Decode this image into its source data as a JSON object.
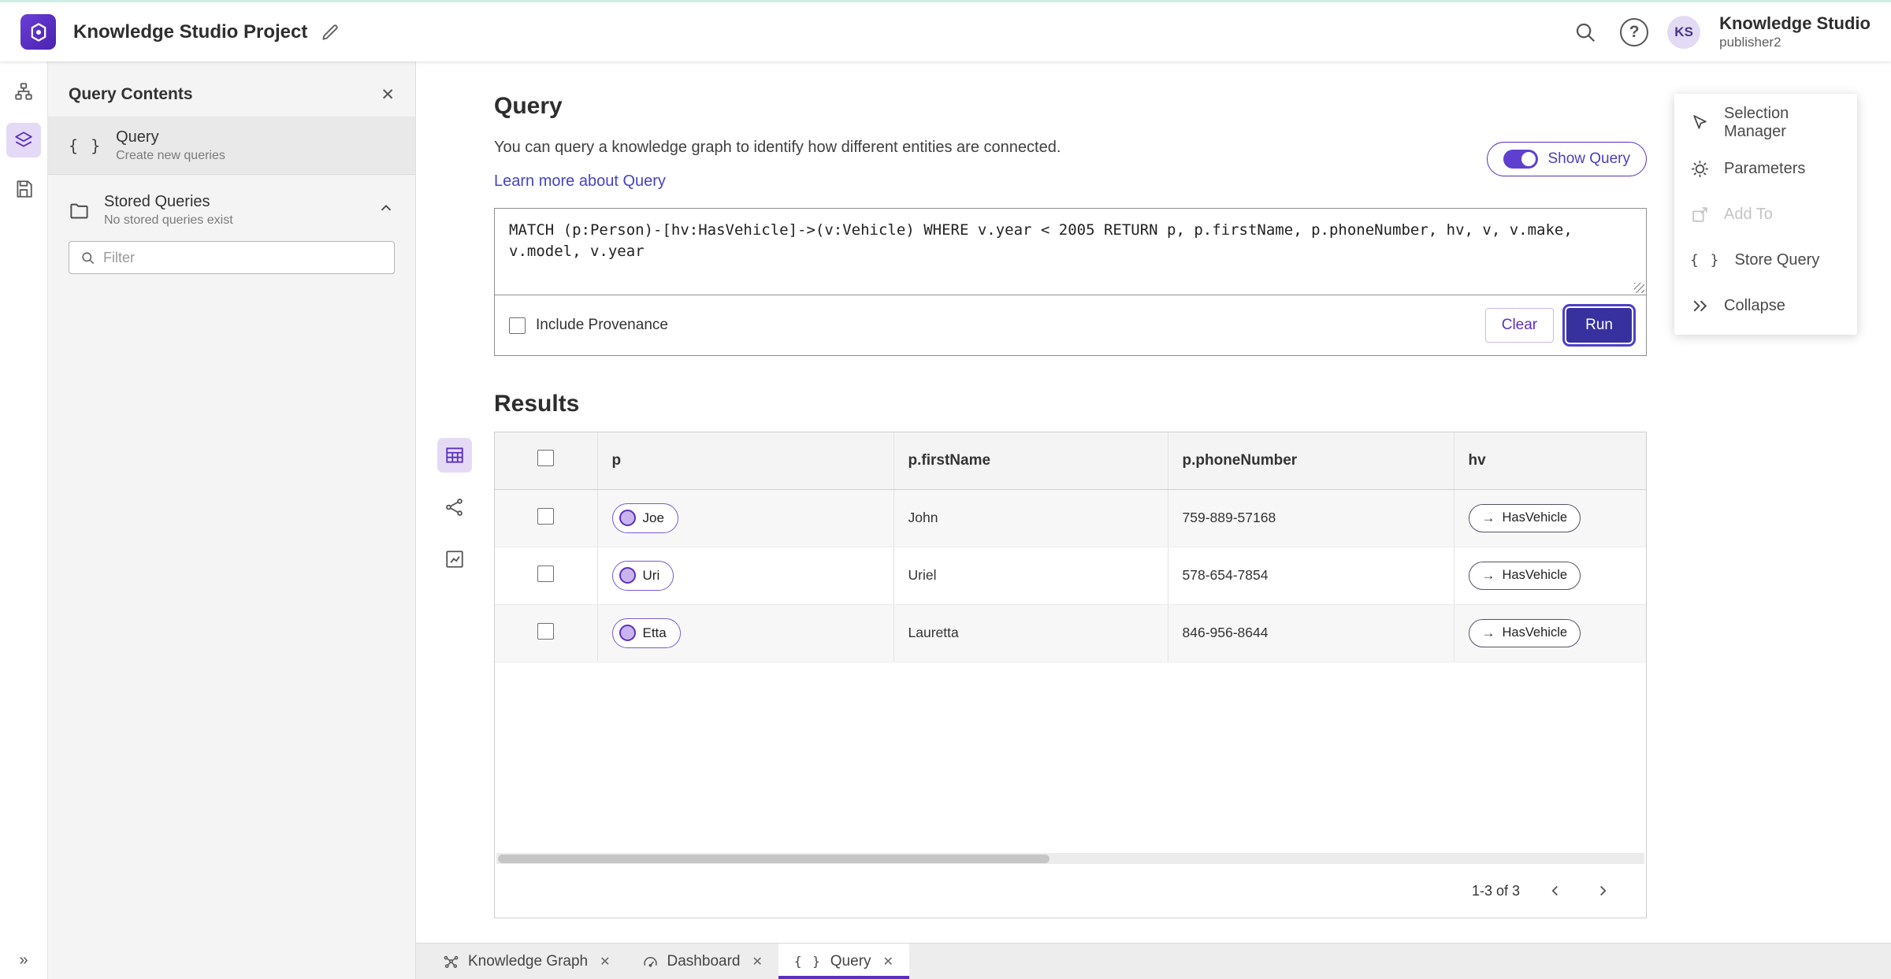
{
  "header": {
    "title": "Knowledge Studio Project",
    "product_name": "Knowledge Studio",
    "user_role": "publisher2",
    "avatar_initials": "KS"
  },
  "left_panel": {
    "title": "Query Contents",
    "query_item": {
      "label": "Query",
      "description": "Create new queries"
    },
    "stored": {
      "label": "Stored Queries",
      "description": "No stored queries exist"
    },
    "filter_placeholder": "Filter"
  },
  "query": {
    "title": "Query",
    "description": "You can query a knowledge graph to identify how different entities are connected.",
    "learn_more": "Learn more about Query",
    "show_query": "Show Query",
    "text": "MATCH (p:Person)-[hv:HasVehicle]->(v:Vehicle) WHERE v.year < 2005 RETURN p, p.firstName, p.phoneNumber, hv, v, v.make, v.model, v.year",
    "include_provenance": "Include Provenance",
    "clear": "Clear",
    "run": "Run"
  },
  "results": {
    "title": "Results",
    "columns": [
      "p",
      "p.firstName",
      "p.phoneNumber",
      "hv"
    ],
    "rows": [
      {
        "p": "Joe",
        "firstName": "John",
        "phoneNumber": "759-889-57168",
        "hv": "HasVehicle"
      },
      {
        "p": "Uri",
        "firstName": "Uriel",
        "phoneNumber": "578-654-7854",
        "hv": "HasVehicle"
      },
      {
        "p": "Etta",
        "firstName": "Lauretta",
        "phoneNumber": "846-956-8644",
        "hv": "HasVehicle"
      }
    ],
    "pagination": "1-3 of 3"
  },
  "menu": {
    "items": [
      {
        "label": "Selection Manager",
        "icon": "selection-manager-icon",
        "disabled": false
      },
      {
        "label": "Parameters",
        "icon": "gear-icon",
        "disabled": false
      },
      {
        "label": "Add To",
        "icon": "add-to-icon",
        "disabled": true
      },
      {
        "label": "Store Query",
        "icon": "braces-icon",
        "disabled": false
      },
      {
        "label": "Collapse",
        "icon": "collapse-icon",
        "disabled": false
      }
    ]
  },
  "tabs": [
    {
      "label": "Knowledge Graph",
      "icon": "graph-icon",
      "active": false
    },
    {
      "label": "Dashboard",
      "icon": "dashboard-icon",
      "active": false
    },
    {
      "label": "Query",
      "icon": "braces-icon",
      "active": true
    }
  ],
  "colors": {
    "accent_purple": "#5a2fc2",
    "run_button": "#37309f",
    "link": "#4543c8",
    "selected_background": "#e4daf6",
    "toggle_on": "#5f3fd0"
  }
}
